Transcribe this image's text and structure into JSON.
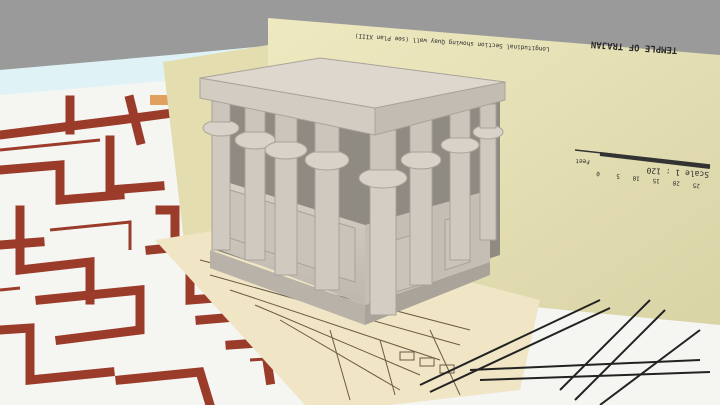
{
  "scene": {
    "kind": "3d-model-viewer",
    "background_color": "#9a9a9a",
    "ground_tint": "#dff3f6",
    "map_path_color": "#9b3b2a",
    "stone_color": "#cfc9c0"
  },
  "drawing_sheet": {
    "title": "TEMPLE OF TRAJAN",
    "caption": "Longitudinal Section showing Quay wall (see Plan XIII)",
    "scale_label": "Scale 1 : 120",
    "scale_ticks": [
      "0",
      "5",
      "10",
      "15",
      "20",
      "25"
    ],
    "unit_label": "Feet",
    "paper_color": "#e7e2b6"
  }
}
